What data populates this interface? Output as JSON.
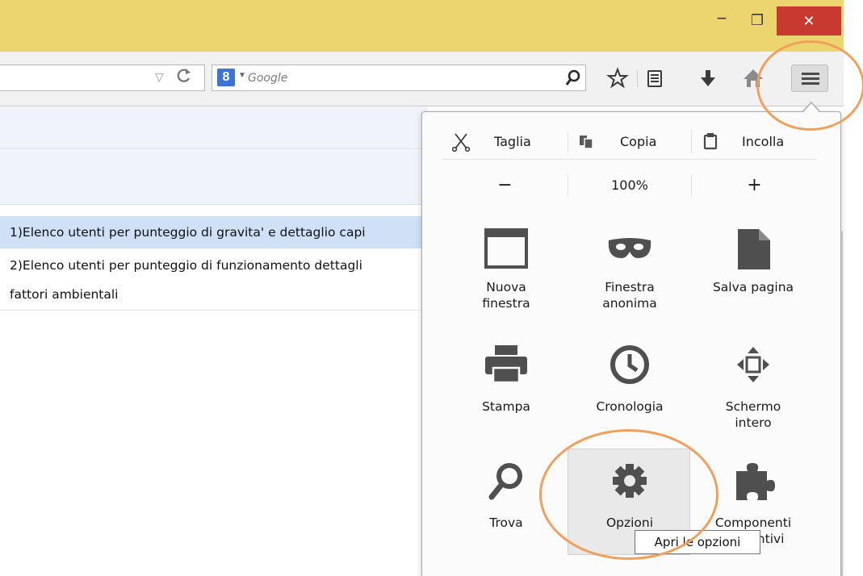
{
  "window": {
    "minimize": "−",
    "maximize": "❐",
    "close": "✕"
  },
  "navbar": {
    "search": {
      "engine_label": "8",
      "placeholder": "Google"
    }
  },
  "content": {
    "rows": [
      "1)Elenco utenti per punteggio di gravita' e dettaglio capi",
      "2)Elenco utenti per punteggio di funzionamento dettagli",
      "fattori ambientali"
    ]
  },
  "menu": {
    "edit": {
      "cut": "Taglia",
      "copy": "Copia",
      "paste": "Incolla"
    },
    "zoom": {
      "out": "−",
      "level": "100%",
      "in": "+"
    },
    "items": [
      {
        "label": "Nuova\nfinestra",
        "icon": "new-window-icon"
      },
      {
        "label": "Finestra\nanonima",
        "icon": "private-mask-icon"
      },
      {
        "label": "Salva pagina",
        "icon": "save-page-icon"
      },
      {
        "label": "Stampa",
        "icon": "print-icon"
      },
      {
        "label": "Cronologia",
        "icon": "history-clock-icon"
      },
      {
        "label": "Schermo\nintero",
        "icon": "fullscreen-icon"
      },
      {
        "label": "Trova",
        "icon": "find-icon"
      },
      {
        "label": "Opzioni",
        "icon": "gear-icon"
      },
      {
        "label": "Componenti\naggiuntivi",
        "icon": "addons-puzzle-icon"
      }
    ],
    "tooltip": "Apri le opzioni"
  },
  "colors": {
    "titlebar": "#ecd56e",
    "close_button": "#c83a30",
    "annotation": "#f0a05a",
    "selected_row": "#cfe0f7"
  }
}
